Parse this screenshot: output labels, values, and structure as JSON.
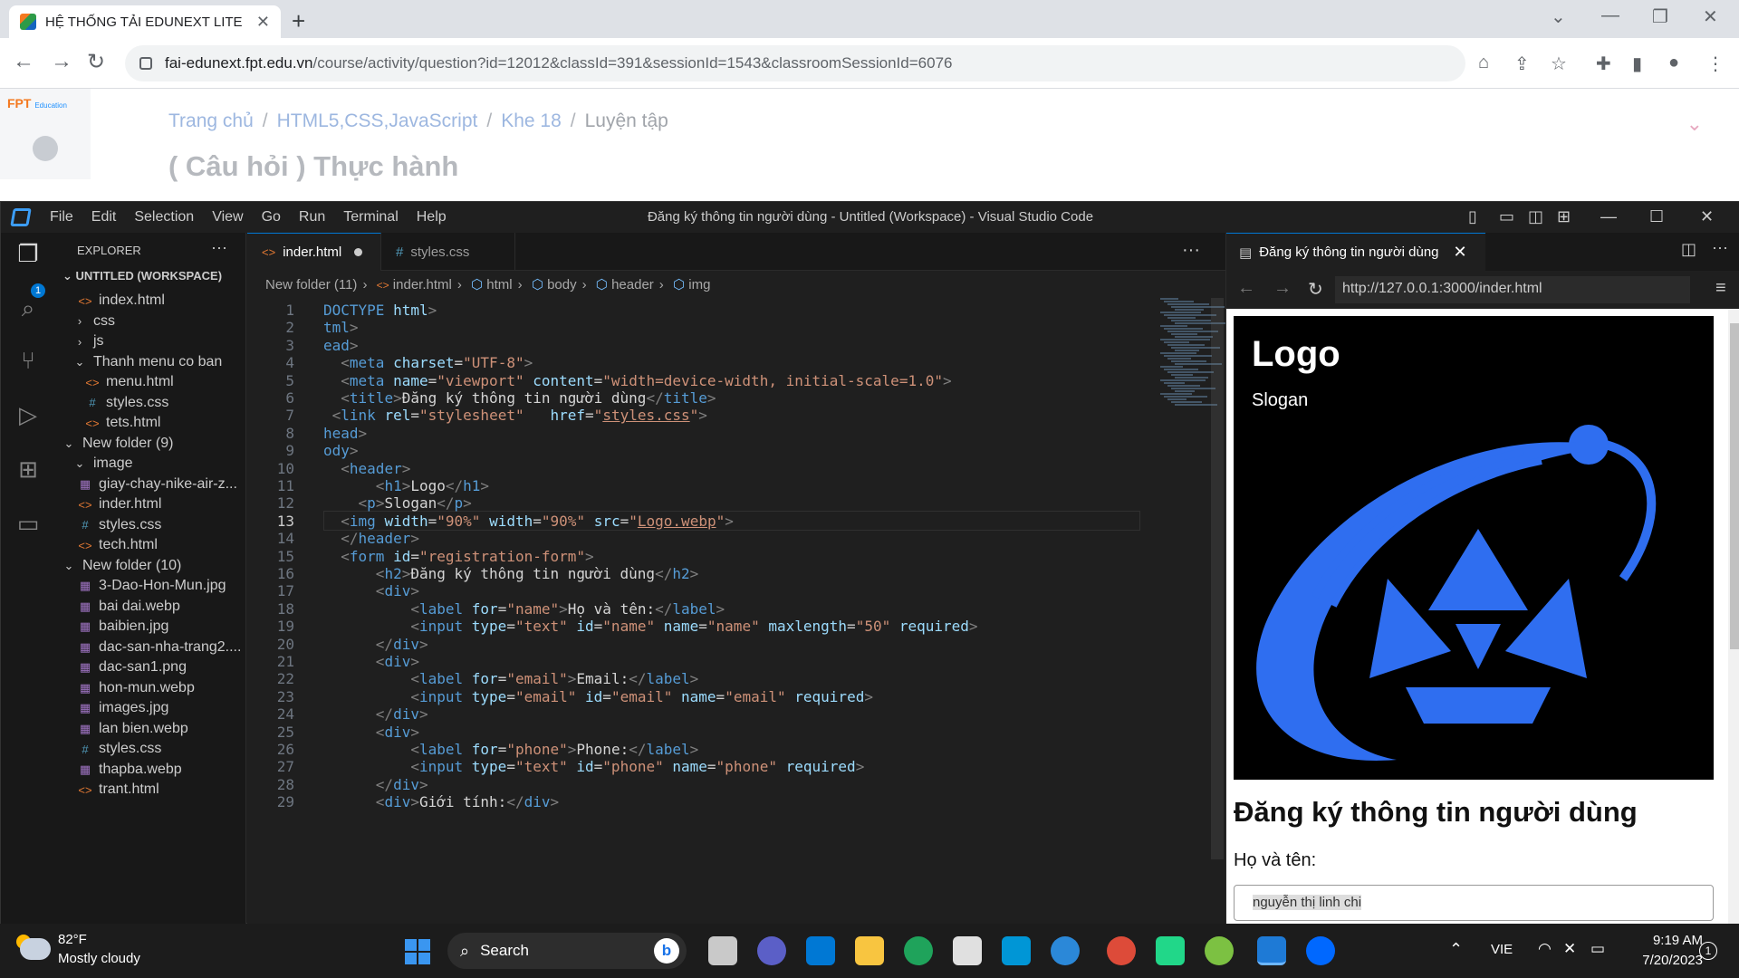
{
  "chrome": {
    "tab_title": "HỆ THỐNG TẢI EDUNEXT LITE",
    "tab_close": "✕",
    "new_tab": "+",
    "url_host": "fai-edunext.fpt.edu.vn",
    "url_path": "/course/activity/question?id=12012&classId=391&sessionId=1543&classroomSessionId=6076"
  },
  "page": {
    "logo_text": "FPT",
    "logo_sub": "Education",
    "breadcrumb": [
      "Trang chủ",
      "HTML5,CSS,JavaScript",
      "Khe 18",
      "Luyện tập"
    ],
    "heading": "( Câu hỏi ) Thực hành"
  },
  "vscode": {
    "menu": [
      "File",
      "Edit",
      "Selection",
      "View",
      "Go",
      "Run",
      "Terminal",
      "Help"
    ],
    "window_title": "Đăng ký thông tin người dùng - Untitled (Workspace) - Visual Studio Code",
    "explorer_label": "EXPLORER",
    "workspace_label": "UNTITLED (WORKSPACE)",
    "badge": "1",
    "tree": [
      {
        "label": "index.html",
        "type": "html",
        "indent": 1
      },
      {
        "label": "css",
        "type": "folder-closed",
        "indent": 1
      },
      {
        "label": "js",
        "type": "folder-closed",
        "indent": 1
      },
      {
        "label": "Thanh menu co ban",
        "type": "folder-open",
        "indent": 1
      },
      {
        "label": "menu.html",
        "type": "html",
        "indent": 2
      },
      {
        "label": "styles.css",
        "type": "css",
        "indent": 2
      },
      {
        "label": "tets.html",
        "type": "html",
        "indent": 2
      },
      {
        "label": "New folder (9)",
        "type": "folder-open",
        "indent": 0
      },
      {
        "label": "image",
        "type": "folder-open",
        "indent": 1
      },
      {
        "label": "giay-chay-nike-air-z...",
        "type": "img",
        "indent": 1
      },
      {
        "label": "inder.html",
        "type": "html",
        "indent": 1
      },
      {
        "label": "styles.css",
        "type": "css",
        "indent": 1
      },
      {
        "label": "tech.html",
        "type": "html",
        "indent": 1
      },
      {
        "label": "New folder (10)",
        "type": "folder-open",
        "indent": 0
      },
      {
        "label": "3-Dao-Hon-Mun.jpg",
        "type": "img",
        "indent": 1
      },
      {
        "label": "bai dai.webp",
        "type": "img",
        "indent": 1
      },
      {
        "label": "baibien.jpg",
        "type": "img",
        "indent": 1
      },
      {
        "label": "dac-san-nha-trang2....",
        "type": "img",
        "indent": 1
      },
      {
        "label": "dac-san1.png",
        "type": "img",
        "indent": 1
      },
      {
        "label": "hon-mun.webp",
        "type": "img",
        "indent": 1
      },
      {
        "label": "images.jpg",
        "type": "img",
        "indent": 1
      },
      {
        "label": "lan bien.webp",
        "type": "img",
        "indent": 1
      },
      {
        "label": "styles.css",
        "type": "css",
        "indent": 1
      },
      {
        "label": "thapba.webp",
        "type": "img",
        "indent": 1
      },
      {
        "label": "trant.html",
        "type": "html",
        "indent": 1
      }
    ],
    "tabs": [
      "inder.html",
      "styles.css"
    ],
    "breadcrumbs": [
      "New folder (11)",
      "inder.html",
      "html",
      "body",
      "header",
      "img"
    ],
    "current_line": "13",
    "code_lines": [
      {
        "n": "1",
        "html": "<span class=\"tg\">DOCTYPE</span> <span class=\"at\">html</span><span class=\"pu\">&gt;</span>"
      },
      {
        "n": "2",
        "html": "<span class=\"tg\">tml</span><span class=\"pu\">&gt;</span>"
      },
      {
        "n": "3",
        "html": "<span class=\"tg\">ead</span><span class=\"pu\">&gt;</span>"
      },
      {
        "n": "4",
        "html": "  <span class=\"pu\">&lt;</span><span class=\"tg\">meta</span> <span class=\"at\">charset</span>=<span class=\"st\">\"UTF-8\"</span><span class=\"pu\">&gt;</span>"
      },
      {
        "n": "5",
        "html": "  <span class=\"pu\">&lt;</span><span class=\"tg\">meta</span> <span class=\"at\">name</span>=<span class=\"st\">\"viewport\"</span> <span class=\"at\">content</span>=<span class=\"st\">\"width=device-width, initial-scale=1.0\"</span><span class=\"pu\">&gt;</span>"
      },
      {
        "n": "6",
        "html": "  <span class=\"pu\">&lt;</span><span class=\"tg\">title</span><span class=\"pu\">&gt;</span><span class=\"tx\">Đăng ký thông tin người dùng</span><span class=\"pu\">&lt;/</span><span class=\"tg\">title</span><span class=\"pu\">&gt;</span>"
      },
      {
        "n": "7",
        "html": " <span class=\"pu\">&lt;</span><span class=\"tg\">link</span> <span class=\"at\">rel</span>=<span class=\"st\">\"stylesheet\"</span>   <span class=\"at\">href</span>=<span class=\"st\">\"<span class=\"ul\">styles.css</span>\"</span><span class=\"pu\">&gt;</span>"
      },
      {
        "n": "8",
        "html": "<span class=\"tg\">head</span><span class=\"pu\">&gt;</span>"
      },
      {
        "n": "9",
        "html": "<span class=\"tg\">ody</span><span class=\"pu\">&gt;</span>"
      },
      {
        "n": "10",
        "html": "  <span class=\"pu\">&lt;</span><span class=\"tg\">header</span><span class=\"pu\">&gt;</span>"
      },
      {
        "n": "11",
        "html": "      <span class=\"pu\">&lt;</span><span class=\"tg\">h1</span><span class=\"pu\">&gt;</span><span class=\"tx\">Logo</span><span class=\"pu\">&lt;/</span><span class=\"tg\">h1</span><span class=\"pu\">&gt;</span>"
      },
      {
        "n": "12",
        "html": "    <span class=\"pu\">&lt;</span><span class=\"tg\">p</span><span class=\"pu\">&gt;</span><span class=\"tx\">Slogan</span><span class=\"pu\">&lt;/</span><span class=\"tg\">p</span><span class=\"pu\">&gt;</span>"
      },
      {
        "n": "13",
        "html": "  <span class=\"pu\">&lt;</span><span class=\"tg\">img</span> <span class=\"at\">width</span>=<span class=\"st\">\"90%\"</span> <span class=\"at\">width</span>=<span class=\"st\">\"90%\"</span> <span class=\"at\">src</span>=<span class=\"st\">\"<span class=\"ul\">Logo.webp</span>\"</span><span class=\"pu\">&gt;</span>"
      },
      {
        "n": "14",
        "html": "  <span class=\"pu\">&lt;/</span><span class=\"tg\">header</span><span class=\"pu\">&gt;</span>"
      },
      {
        "n": "15",
        "html": "  <span class=\"pu\">&lt;</span><span class=\"tg\">form</span> <span class=\"at\">id</span>=<span class=\"st\">\"registration-form\"</span><span class=\"pu\">&gt;</span>"
      },
      {
        "n": "16",
        "html": "      <span class=\"pu\">&lt;</span><span class=\"tg\">h2</span><span class=\"pu\">&gt;</span><span class=\"tx\">Đăng ký thông tin người dùng</span><span class=\"pu\">&lt;/</span><span class=\"tg\">h2</span><span class=\"pu\">&gt;</span>"
      },
      {
        "n": "17",
        "html": "      <span class=\"pu\">&lt;</span><span class=\"tg\">div</span><span class=\"pu\">&gt;</span>"
      },
      {
        "n": "18",
        "html": "          <span class=\"pu\">&lt;</span><span class=\"tg\">label</span> <span class=\"at\">for</span>=<span class=\"st\">\"name\"</span><span class=\"pu\">&gt;</span><span class=\"tx\">Họ và tên:</span><span class=\"pu\">&lt;/</span><span class=\"tg\">label</span><span class=\"pu\">&gt;</span>"
      },
      {
        "n": "19",
        "html": "          <span class=\"pu\">&lt;</span><span class=\"tg\">input</span> <span class=\"at\">type</span>=<span class=\"st\">\"text\"</span> <span class=\"at\">id</span>=<span class=\"st\">\"name\"</span> <span class=\"at\">name</span>=<span class=\"st\">\"name\"</span> <span class=\"at\">maxlength</span>=<span class=\"st\">\"50\"</span> <span class=\"at\">required</span><span class=\"pu\">&gt;</span>"
      },
      {
        "n": "20",
        "html": "      <span class=\"pu\">&lt;/</span><span class=\"tg\">div</span><span class=\"pu\">&gt;</span>"
      },
      {
        "n": "21",
        "html": "      <span class=\"pu\">&lt;</span><span class=\"tg\">div</span><span class=\"pu\">&gt;</span>"
      },
      {
        "n": "22",
        "html": "          <span class=\"pu\">&lt;</span><span class=\"tg\">label</span> <span class=\"at\">for</span>=<span class=\"st\">\"email\"</span><span class=\"pu\">&gt;</span><span class=\"tx\">Email:</span><span class=\"pu\">&lt;/</span><span class=\"tg\">label</span><span class=\"pu\">&gt;</span>"
      },
      {
        "n": "23",
        "html": "          <span class=\"pu\">&lt;</span><span class=\"tg\">input</span> <span class=\"at\">type</span>=<span class=\"st\">\"email\"</span> <span class=\"at\">id</span>=<span class=\"st\">\"email\"</span> <span class=\"at\">name</span>=<span class=\"st\">\"email\"</span> <span class=\"at\">required</span><span class=\"pu\">&gt;</span>"
      },
      {
        "n": "24",
        "html": "      <span class=\"pu\">&lt;/</span><span class=\"tg\">div</span><span class=\"pu\">&gt;</span>"
      },
      {
        "n": "25",
        "html": "      <span class=\"pu\">&lt;</span><span class=\"tg\">div</span><span class=\"pu\">&gt;</span>"
      },
      {
        "n": "26",
        "html": "          <span class=\"pu\">&lt;</span><span class=\"tg\">label</span> <span class=\"at\">for</span>=<span class=\"st\">\"phone\"</span><span class=\"pu\">&gt;</span><span class=\"tx\">Phone:</span><span class=\"pu\">&lt;/</span><span class=\"tg\">label</span><span class=\"pu\">&gt;</span>"
      },
      {
        "n": "27",
        "html": "          <span class=\"pu\">&lt;</span><span class=\"tg\">input</span> <span class=\"at\">type</span>=<span class=\"st\">\"text\"</span> <span class=\"at\">id</span>=<span class=\"st\">\"phone\"</span> <span class=\"at\">name</span>=<span class=\"st\">\"phone\"</span> <span class=\"at\">required</span><span class=\"pu\">&gt;</span>"
      },
      {
        "n": "28",
        "html": "      <span class=\"pu\">&lt;/</span><span class=\"tg\">div</span><span class=\"pu\">&gt;</span>"
      },
      {
        "n": "29",
        "html": "      <span class=\"pu\">&lt;</span><span class=\"tg\">div</span><span class=\"pu\">&gt;</span><span class=\"tx\">Giới tính:</span><span class=\"pu\">&lt;/</span><span class=\"tg\">div</span><span class=\"pu\">&gt;</span>"
      }
    ]
  },
  "preview": {
    "tab_title": "Đăng ký thông tin người dùng",
    "url": "http://127.0.0.1:3000/inder.html",
    "logo_heading": "Logo",
    "slogan": "Slogan",
    "form_heading": "Đăng ký thông tin người dùng",
    "name_label": "Họ và tên:",
    "name_value": "nguyễn thị linh chi"
  },
  "taskbar": {
    "temperature": "82°F",
    "weather": "Mostly cloudy",
    "search_label": "Search",
    "language": "VIE",
    "time": "9:19 AM",
    "date": "7/20/2023",
    "notifications": "1"
  }
}
